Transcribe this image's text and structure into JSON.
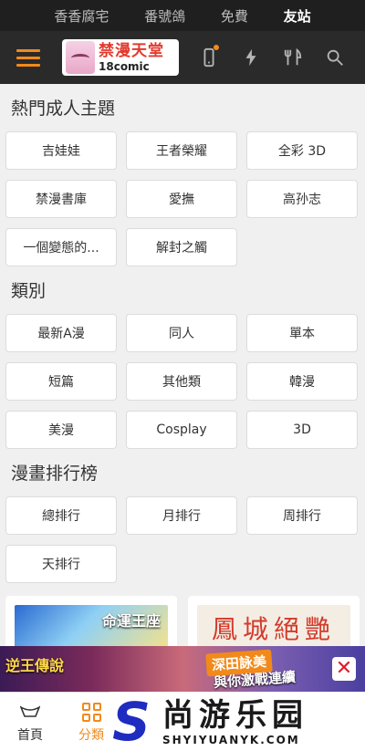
{
  "topbar": {
    "links": [
      "香香腐宅",
      "番號鴿",
      "免費",
      "友站"
    ]
  },
  "header": {
    "logo_title": "禁漫天堂",
    "logo_sub": "18comic"
  },
  "sections": [
    {
      "title": "熱門成人主題",
      "items": [
        "吉娃娃",
        "王者榮耀",
        "全彩 3D",
        "禁漫書庫",
        "愛撫",
        "高孙志",
        "一個變態的...",
        "解封之觸"
      ]
    },
    {
      "title": "類別",
      "items": [
        "最新A漫",
        "同人",
        "單本",
        "短篇",
        "其他類",
        "韓漫",
        "美漫",
        "Cosplay",
        "3D"
      ]
    },
    {
      "title": "漫畫排行榜",
      "items": [
        "總排行",
        "月排行",
        "周排行",
        "天排行"
      ]
    }
  ],
  "cards": {
    "left_caption": "命運王座",
    "right_caption": "鳳城絕艷"
  },
  "ad": {
    "left_text": "逆王傳說",
    "right_tag": "深田詠美",
    "right_text": "與你激戰連續",
    "close_label": "✕"
  },
  "bottom_nav": [
    {
      "label": "首頁"
    },
    {
      "label": "分類"
    }
  ],
  "watermark": {
    "mark": "S",
    "cn": "尚游乐园",
    "en": "SHYIYUANYK.COM"
  },
  "colors": {
    "accent": "#f28a1a",
    "topbar_bg": "#1f1f1f",
    "header_bg": "#2a2a2a",
    "page_bg": "#f0f0f0"
  }
}
